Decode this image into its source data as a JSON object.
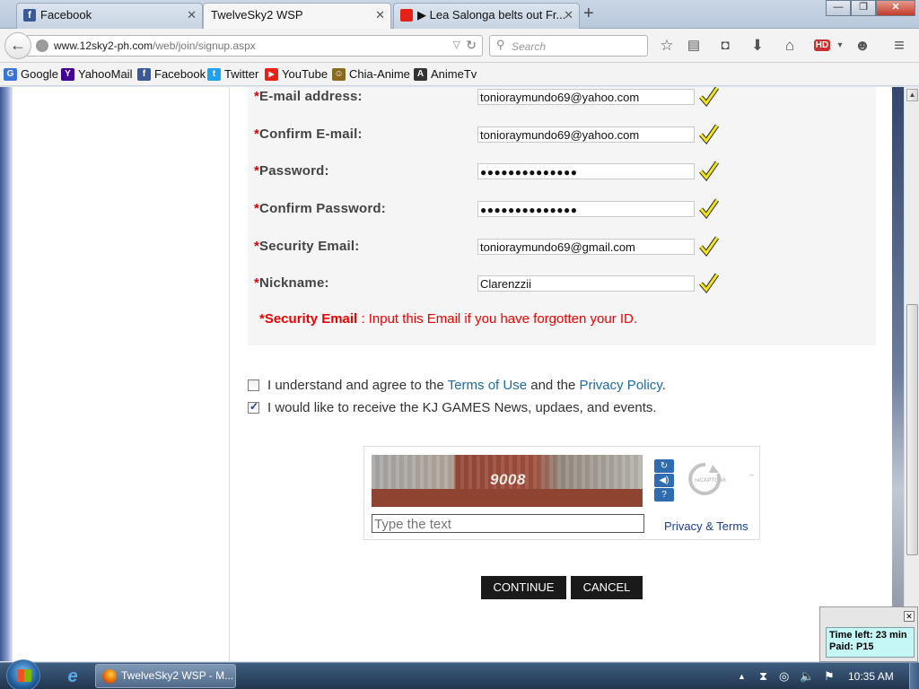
{
  "browser": {
    "tabs": [
      {
        "title": "Facebook",
        "active": false,
        "favicon_color": "#3b5998"
      },
      {
        "title": "TwelveSky2 WSP",
        "active": true,
        "favicon_color": ""
      },
      {
        "title": "▶ Lea Salonga belts out Fr...",
        "active": false,
        "favicon_color": "#e62117"
      }
    ],
    "new_tab": "+",
    "window_controls": {
      "minimize": "—",
      "maximize": "❐",
      "close": "✕"
    },
    "url_prefix": "www.12sky2-ph.com",
    "url_rest": "/web/join/signup.aspx",
    "search_placeholder": "Search",
    "bookmarks": [
      {
        "label": "Google",
        "icon": "G",
        "color": "#3b74d8"
      },
      {
        "label": "YahooMail",
        "icon": "Y",
        "color": "#410093"
      },
      {
        "label": "Facebook",
        "icon": "f",
        "color": "#3b5998"
      },
      {
        "label": "Twitter",
        "icon": "t",
        "color": "#1da1f2"
      },
      {
        "label": "YouTube",
        "icon": "▶",
        "color": "#e62117"
      },
      {
        "label": "Chia-Anime",
        "icon": "☺",
        "color": "#8a6a1c"
      },
      {
        "label": "AnimeTv",
        "icon": "A",
        "color": "#333333"
      }
    ]
  },
  "form": {
    "rows": [
      {
        "label": "E-mail address:",
        "value": "tonioraymundo69@yahoo.com",
        "password": false
      },
      {
        "label": "Confirm E-mail:",
        "value": "tonioraymundo69@yahoo.com",
        "password": false
      },
      {
        "label": "Password:",
        "value": "●●●●●●●●●●●●●●",
        "password": true
      },
      {
        "label": "Confirm Password:",
        "value": "●●●●●●●●●●●●●●",
        "password": true
      },
      {
        "label": "Security Email:",
        "value": "tonioraymundo69@gmail.com",
        "password": false
      },
      {
        "label": "Nickname:",
        "value": "Clarenzzii",
        "password": false
      }
    ],
    "required_mark": "*",
    "security_note": {
      "strong": "*Security Email",
      "rest": " : Input this Email if you have forgotten your ID."
    }
  },
  "agreements": [
    {
      "checked": false,
      "before": "I understand and agree to the ",
      "link1": "Terms of Use",
      "middle": " and the ",
      "link2": "Privacy Policy",
      "after": "."
    },
    {
      "checked": true,
      "before": "I would like to receive the KJ GAMES News, updaes, and events.",
      "link1": "",
      "middle": "",
      "link2": "",
      "after": ""
    }
  ],
  "captcha": {
    "image_text": "9008",
    "input_placeholder": "Type the text",
    "privacy": "Privacy & Terms",
    "logo_text": "reCAPTCHA",
    "logo_tm": "TM"
  },
  "buttons": {
    "continue": "CONTINUE",
    "cancel": "CANCEL"
  },
  "timer": {
    "time_left": "Time left: 23 min",
    "paid": "Paid: P15"
  },
  "taskbar": {
    "window_label": "TwelveSky2 WSP - M...",
    "clock": "10:35 AM"
  }
}
